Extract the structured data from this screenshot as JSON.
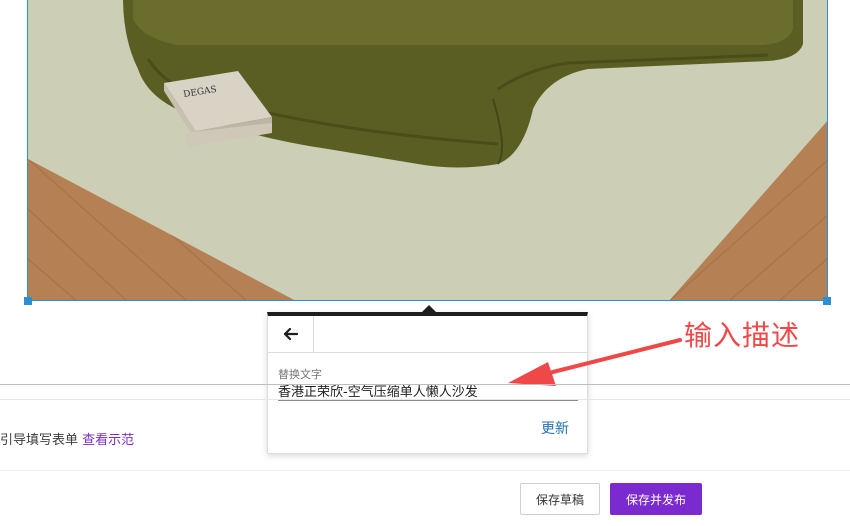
{
  "image": {
    "book_title": "DEGAS"
  },
  "popover": {
    "back_icon": "arrow-left-icon",
    "alt_label": "替换文字",
    "alt_value": "香港正荣欣-空气压缩单人懒人沙发",
    "update_label": "更新"
  },
  "annotation": {
    "text": "输入描述",
    "color": "#f04848"
  },
  "hint": {
    "text": "引导填写表单",
    "link": "查看示范"
  },
  "footer": {
    "save_draft": "保存草稿",
    "save_publish": "保存并发布"
  },
  "colors": {
    "selection": "#2b8fd6",
    "primary": "#7b2ad0",
    "link": "#2271b1"
  }
}
